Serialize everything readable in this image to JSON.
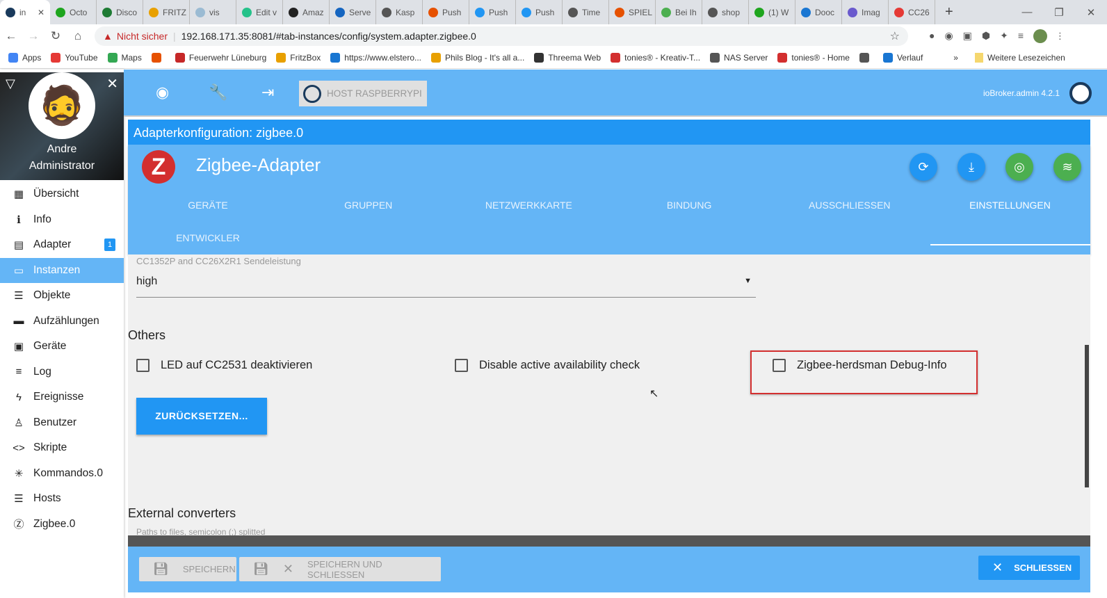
{
  "browser": {
    "tabs": [
      {
        "label": "in",
        "color": "#1a3a5c"
      },
      {
        "label": "Octo",
        "color": "#1ea51e"
      },
      {
        "label": "Disco",
        "color": "#1e7b34"
      },
      {
        "label": "FRITZ",
        "color": "#e8a000"
      },
      {
        "label": "vis",
        "color": "#9bbbd3"
      },
      {
        "label": "Edit v",
        "color": "#25c28a"
      },
      {
        "label": "Amaz",
        "color": "#222"
      },
      {
        "label": "Serve",
        "color": "#1565c0"
      },
      {
        "label": "Kasp",
        "color": "#555"
      },
      {
        "label": "Push",
        "color": "#e65100"
      },
      {
        "label": "Push",
        "color": "#2196f3"
      },
      {
        "label": "Push",
        "color": "#2196f3"
      },
      {
        "label": "Time",
        "color": "#555"
      },
      {
        "label": "SPIEL",
        "color": "#e65100"
      },
      {
        "label": "Bei Ih",
        "color": "#4caf50"
      },
      {
        "label": "shop",
        "color": "#555"
      },
      {
        "label": "(1) W",
        "color": "#1ea51e"
      },
      {
        "label": "Dooc",
        "color": "#1976d2"
      },
      {
        "label": "Imag",
        "color": "#6a5acd"
      },
      {
        "label": "CC26",
        "color": "#e53935"
      }
    ],
    "new_tab": "+",
    "security_label": "Nicht sicher",
    "url": "192.168.171.35:8081/#tab-instances/config/system.adapter.zigbee.0",
    "bookmarks": [
      "Apps",
      "YouTube",
      "Maps",
      "",
      "Feuerwehr Lüneburg",
      "FritzBox",
      "https://www.elstero...",
      "Phils Blog - It's all a...",
      "Threema Web",
      "tonies® - Kreativ-T...",
      "NAS Server",
      "tonies® - Home",
      "",
      "Verlauf"
    ],
    "bookmarks_more": "»",
    "other_bookmarks": "Weitere Lesezeichen"
  },
  "sidebar": {
    "user_name": "Andre",
    "user_role": "Administrator",
    "items": [
      {
        "label": "Übersicht",
        "icon": "grid-icon",
        "glyph": "▦"
      },
      {
        "label": "Info",
        "icon": "info-icon",
        "glyph": "ℹ"
      },
      {
        "label": "Adapter",
        "icon": "store-icon",
        "glyph": "▤",
        "badge": "1"
      },
      {
        "label": "Instanzen",
        "icon": "instances-icon",
        "glyph": "▭",
        "active": true
      },
      {
        "label": "Objekte",
        "icon": "list-icon",
        "glyph": "☰"
      },
      {
        "label": "Aufzählungen",
        "icon": "enum-icon",
        "glyph": "▬"
      },
      {
        "label": "Geräte",
        "icon": "devices-icon",
        "glyph": "▣"
      },
      {
        "label": "Log",
        "icon": "log-icon",
        "glyph": "≡"
      },
      {
        "label": "Ereignisse",
        "icon": "bolt-icon",
        "glyph": "ϟ"
      },
      {
        "label": "Benutzer",
        "icon": "user-icon",
        "glyph": "♙"
      },
      {
        "label": "Skripte",
        "icon": "code-icon",
        "glyph": "<>"
      },
      {
        "label": "Kommandos.0",
        "icon": "asterisk-icon",
        "glyph": "✳"
      },
      {
        "label": "Hosts",
        "icon": "hosts-icon",
        "glyph": "☰"
      },
      {
        "label": "Zigbee.0",
        "icon": "zigbee-icon",
        "glyph": "Ⓩ"
      }
    ]
  },
  "appbar": {
    "host_label": "HOST RASPBERRYPI",
    "version": "ioBroker.admin 4.2.1"
  },
  "dialog": {
    "title": "Adapterkonfiguration: zigbee.0",
    "adapter_name": "Zigbee-Adapter",
    "tabs": [
      "GERÄTE",
      "GRUPPEN",
      "NETZWERKKARTE",
      "BINDUNG",
      "AUSSCHLIESSEN",
      "EINSTELLUNGEN",
      "ENTWICKLER"
    ],
    "active_tab": "EINSTELLUNGEN",
    "power_label": "CC1352P and CC26X2R1 Sendeleistung",
    "power_value": "high",
    "others_heading": "Others",
    "checkboxes": [
      {
        "label": "LED auf CC2531 deaktivieren",
        "checked": false
      },
      {
        "label": "Disable active availability check",
        "checked": false
      },
      {
        "label": "Zigbee-herdsman Debug-Info",
        "checked": false,
        "highlighted": true
      }
    ],
    "reset_button": "ZURÜCKSETZEN...",
    "converters_heading": "External converters",
    "converters_hint": "Paths to files, semicolon (;) splitted",
    "save": "SPEICHERN",
    "save_close": "SPEICHERN UND SCHLIESSEN",
    "close": "SCHLIESSEN"
  },
  "colors": {
    "primary": "#2196f3",
    "light": "#64b5f6",
    "green": "#4caf50",
    "highlight": "#d32f2f"
  }
}
